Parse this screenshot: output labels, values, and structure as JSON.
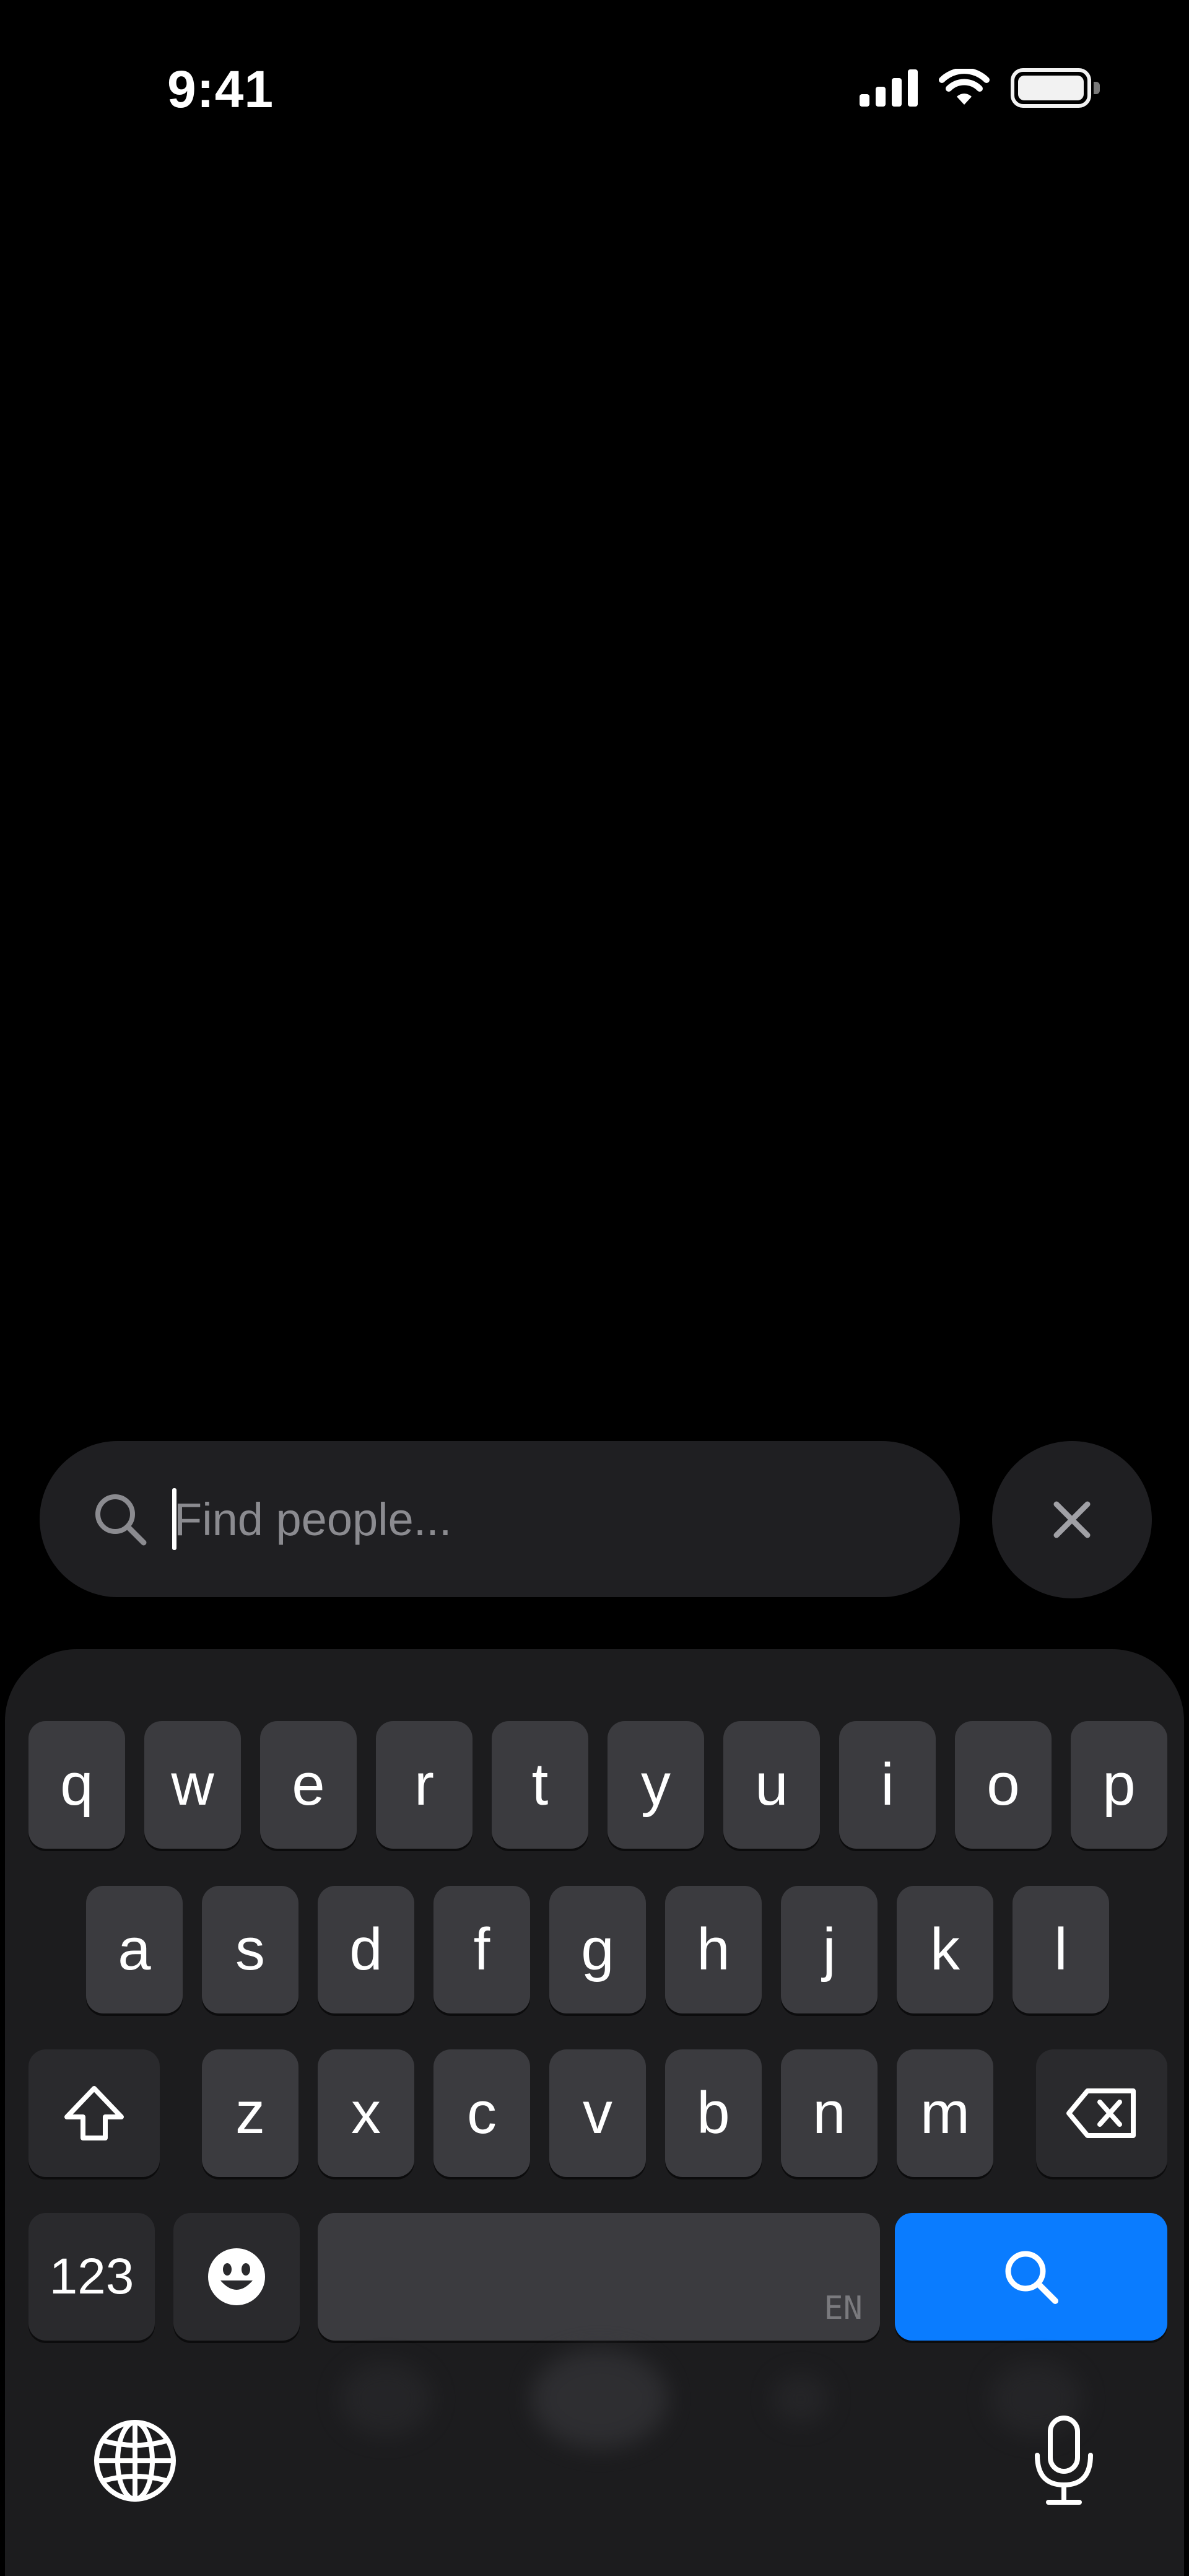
{
  "status_bar": {
    "time": "9:41",
    "icons": [
      "cellular-signal-icon",
      "wifi-icon",
      "battery-icon"
    ]
  },
  "search": {
    "placeholder": "Find people...",
    "value": "",
    "icon": "search-icon",
    "close_icon": "close-icon"
  },
  "keyboard": {
    "row1": [
      "q",
      "w",
      "e",
      "r",
      "t",
      "y",
      "u",
      "i",
      "o",
      "p"
    ],
    "row2": [
      "a",
      "s",
      "d",
      "f",
      "g",
      "h",
      "j",
      "k",
      "l"
    ],
    "row3": [
      "z",
      "x",
      "c",
      "v",
      "b",
      "n",
      "m"
    ],
    "numbers_label": "123",
    "space_language": "EN",
    "icons": {
      "shift": "shift-icon",
      "delete": "backspace-icon",
      "emoji": "emoji-icon",
      "search": "search-icon",
      "globe": "globe-icon",
      "mic": "microphone-icon"
    }
  },
  "colors": {
    "background": "#000000",
    "field": "#1f1f22",
    "keyboard": "#1c1c1e",
    "key": "#3b3b3f",
    "accent": "#0a7cff"
  }
}
